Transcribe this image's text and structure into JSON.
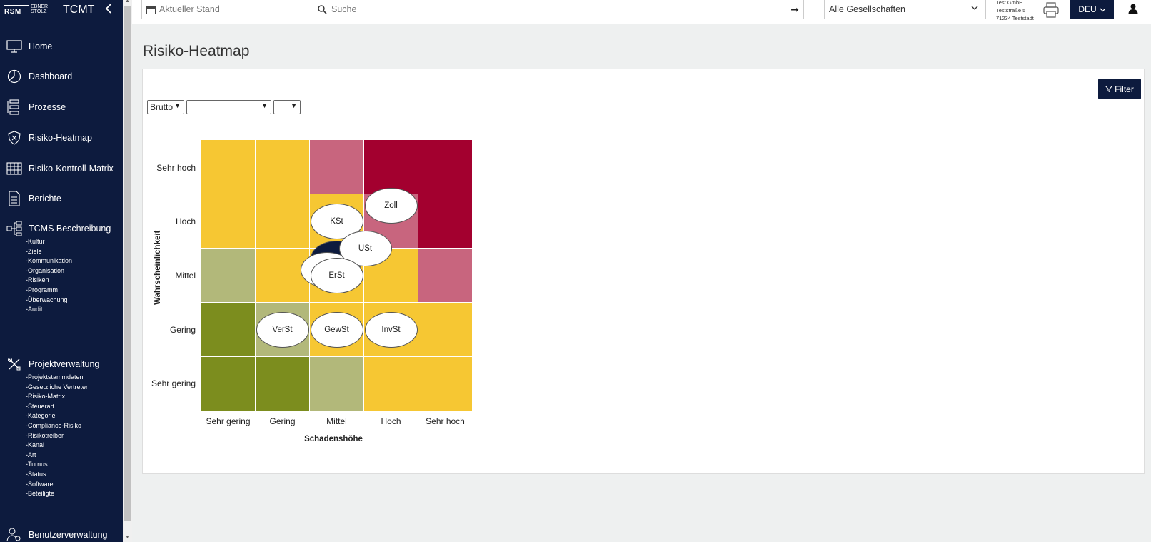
{
  "sidebar": {
    "logo_primary": "RSM",
    "logo_secondary": "EBNER STOLZ",
    "app_title": "TCMT",
    "items": [
      {
        "label": "Home",
        "icon": "monitor-icon"
      },
      {
        "label": "Dashboard",
        "icon": "pie-chart-icon"
      },
      {
        "label": "Prozesse",
        "icon": "process-icon"
      },
      {
        "label": "Risiko-Heatmap",
        "icon": "shield-x-icon"
      },
      {
        "label": "Risiko-Kontroll-Matrix",
        "icon": "grid-icon"
      },
      {
        "label": "Berichte",
        "icon": "document-icon"
      },
      {
        "label": "TCMS Beschreibung",
        "icon": "hierarchy-icon"
      },
      {
        "label": "Projektverwaltung",
        "icon": "tools-icon"
      },
      {
        "label": "Benutzerverwaltung",
        "icon": "users-gear-icon"
      }
    ],
    "tcms_sub": [
      "-Kultur",
      "-Ziele",
      "-Kommunikation",
      "-Organisation",
      "-Risiken",
      "-Programm",
      "-Überwachung",
      "-Audit"
    ],
    "projekt_sub": [
      "-Projektstammdaten",
      "-Gesetzliche Vertreter",
      "-Risiko-Matrix",
      "-Steuerart",
      "-Kategorie",
      "-Compliance-Risiko",
      "-Risikotreiber",
      "-Kanal",
      "-Art",
      "-Turnus",
      "-Status",
      "-Software",
      "-Beteiligte"
    ]
  },
  "topbar": {
    "stand_placeholder": "Aktueller Stand",
    "search_placeholder": "Suche",
    "company_select": "Alle Gesellschaften",
    "company_info": [
      "Test GmbH",
      "Teststraße 5",
      "71234 Teststadt"
    ],
    "language": "DEU"
  },
  "main": {
    "page_title": "Risiko-Heatmap",
    "filter_label": "Filter",
    "select_mode": "Brutto",
    "select_2": "",
    "select_3": ""
  },
  "heatmap": {
    "y_axis_label": "Wahrscheinlichkeit",
    "x_axis_label": "Schadenshöhe",
    "rows": [
      "Sehr hoch",
      "Hoch",
      "Mittel",
      "Gering",
      "Sehr gering"
    ],
    "cols": [
      "Sehr gering",
      "Gering",
      "Mittel",
      "Hoch",
      "Sehr hoch"
    ],
    "colors": {
      "yellow": "#f6c733",
      "pink": "#c8657e",
      "crimson": "#a3002f",
      "olive_light": "#b2b87a",
      "olive_dark": "#7c8d1e"
    },
    "cell_colors": [
      [
        "yellow",
        "yellow",
        "pink",
        "crimson",
        "crimson"
      ],
      [
        "yellow",
        "yellow",
        "yellow",
        "pink",
        "crimson"
      ],
      [
        "olive_light",
        "yellow",
        "yellow",
        "yellow",
        "pink"
      ],
      [
        "olive_dark",
        "olive_light",
        "yellow",
        "yellow",
        "yellow"
      ],
      [
        "olive_dark",
        "olive_dark",
        "olive_light",
        "yellow",
        "yellow"
      ]
    ],
    "risks": [
      {
        "label": "Zoll",
        "likelihood": "Hoch",
        "impact": "Hoch"
      },
      {
        "label": "KSt",
        "likelihood": "Hoch",
        "impact": "Mittel"
      },
      {
        "label": "",
        "likelihood": "Mittel",
        "impact": "Mittel",
        "style": "dark"
      },
      {
        "label": "",
        "likelihood": "Mittel",
        "impact": "Mittel"
      },
      {
        "label": "USt",
        "likelihood": "Mittel",
        "impact": "Mittel"
      },
      {
        "label": "ErSt",
        "likelihood": "Mittel",
        "impact": "Mittel"
      },
      {
        "label": "VerSt",
        "likelihood": "Gering",
        "impact": "Gering"
      },
      {
        "label": "GewSt",
        "likelihood": "Gering",
        "impact": "Mittel"
      },
      {
        "label": "InvSt",
        "likelihood": "Gering",
        "impact": "Hoch"
      }
    ]
  }
}
